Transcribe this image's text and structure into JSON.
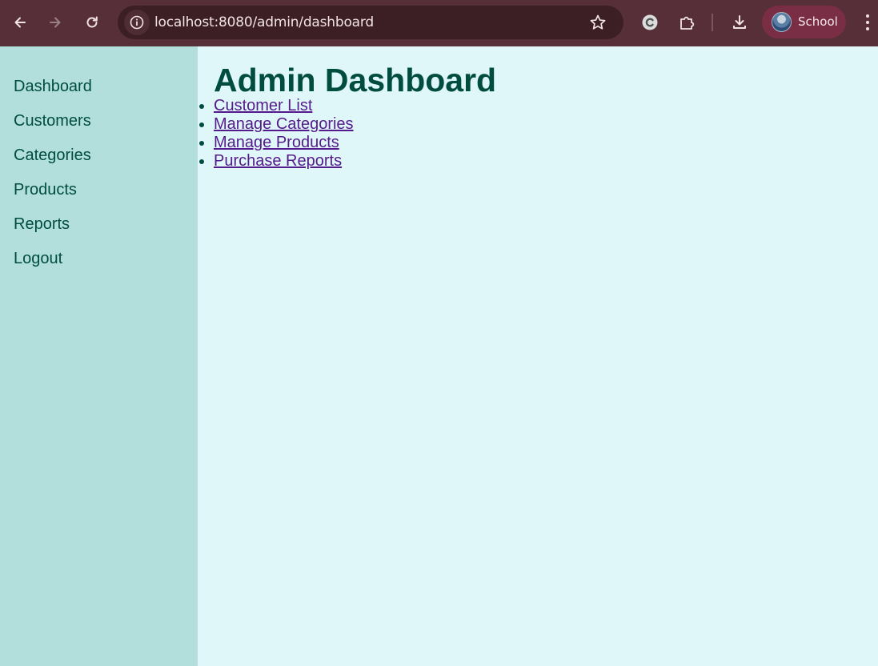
{
  "browser": {
    "url": "localhost:8080/admin/dashboard",
    "profile_label": "School",
    "icons": {
      "back": "arrow-left-icon",
      "forward": "arrow-right-icon",
      "reload": "reload-icon",
      "site_info": "info-icon",
      "bookmark": "star-icon",
      "extension_c": "c-extension-icon",
      "extensions": "puzzle-icon",
      "downloads": "download-icon",
      "menu": "kebab-menu-icon"
    }
  },
  "sidebar": {
    "items": [
      {
        "label": "Dashboard"
      },
      {
        "label": "Customers"
      },
      {
        "label": "Categories"
      },
      {
        "label": "Products"
      },
      {
        "label": "Reports"
      },
      {
        "label": "Logout"
      }
    ]
  },
  "main": {
    "title": "Admin Dashboard",
    "links": [
      {
        "label": "Customer List"
      },
      {
        "label": "Manage Categories"
      },
      {
        "label": "Manage Products"
      },
      {
        "label": "Purchase Reports"
      }
    ]
  },
  "colors": {
    "browser_frame": "#562f38",
    "omnibox": "#3c1f25",
    "profile_chip": "#7a2e45",
    "page_background": "#e0f7fa",
    "sidebar_background": "#b2dfdb",
    "text_dark_teal": "#004d40",
    "visited_link": "#551a8b"
  }
}
